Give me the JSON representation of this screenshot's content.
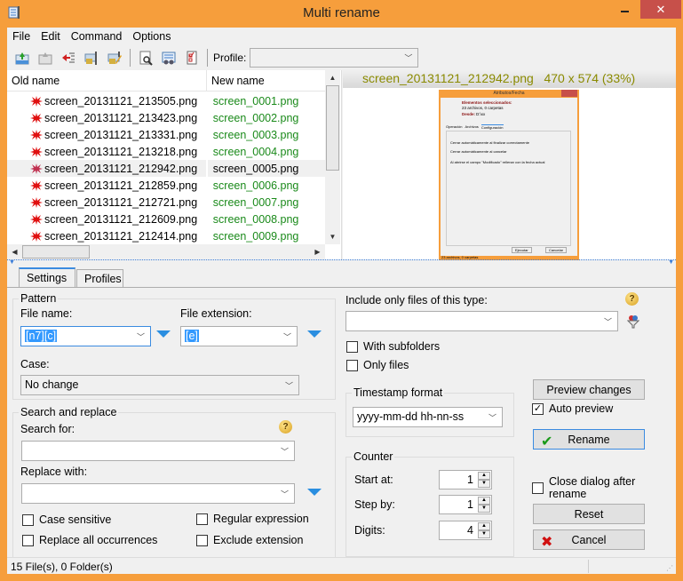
{
  "window": {
    "title": "Multi rename"
  },
  "menu": [
    "File",
    "Edit",
    "Command",
    "Options"
  ],
  "toolbar": {
    "buttons": [
      "load-names-icon",
      "load-names-disabled-icon",
      "undo-icon",
      "lock-rename-icon",
      "edit-rename-icon",
      "preview-icon",
      "compare-icon",
      "checklist-icon"
    ],
    "profile_label": "Profile:",
    "profile_value": ""
  },
  "filelist": {
    "col_old": "Old name",
    "col_new": "New name",
    "rows": [
      {
        "old": "screen_20131121_213505.png",
        "new": "screen_0001.png",
        "selected": false
      },
      {
        "old": "screen_20131121_213423.png",
        "new": "screen_0002.png",
        "selected": false
      },
      {
        "old": "screen_20131121_213331.png",
        "new": "screen_0003.png",
        "selected": false
      },
      {
        "old": "screen_20131121_213218.png",
        "new": "screen_0004.png",
        "selected": false
      },
      {
        "old": "screen_20131121_212942.png",
        "new": "screen_0005.png",
        "selected": true
      },
      {
        "old": "screen_20131121_212859.png",
        "new": "screen_0006.png",
        "selected": false
      },
      {
        "old": "screen_20131121_212721.png",
        "new": "screen_0007.png",
        "selected": false
      },
      {
        "old": "screen_20131121_212609.png",
        "new": "screen_0008.png",
        "selected": false
      },
      {
        "old": "screen_20131121_212414.png",
        "new": "screen_0009.png",
        "selected": false
      }
    ]
  },
  "preview": {
    "filename": "screen_20131121_212942.png",
    "info": "470 x 574 (33%)",
    "thumb": {
      "title": "Atributos/Fecha",
      "selected_label": "Elementos seleccionados:",
      "selected_value": "23 archivos, 0 carpetas",
      "from_label": "Desde:",
      "from_value": "D:\\xx",
      "tabs": [
        "Operación",
        "Archivos",
        "Configuración"
      ],
      "options": [
        {
          "label": "Cerrar automáticamente al finalizar correctamente",
          "checked": true
        },
        {
          "label": "Cerrar automáticamente al cancelar",
          "checked": false
        },
        {
          "label": "Al abrirse el campo \"Modificado\" rellenar con la fecha actual",
          "checked": false
        }
      ],
      "ok": "Ejecutar",
      "cancel": "Cancelar",
      "status": "23 archivos, 0 carpetas"
    }
  },
  "tabs": [
    "Settings",
    "Profiles"
  ],
  "settings": {
    "pattern_title": "Pattern",
    "filename_label": "File name:",
    "filename_value": "[n7][c]",
    "ext_label": "File extension:",
    "ext_value": "[e]",
    "case_label": "Case:",
    "case_value": "No change",
    "sr_title": "Search and replace",
    "search_label": "Search for:",
    "search_value": "",
    "replace_label": "Replace with:",
    "replace_value": "",
    "case_sensitive": "Case sensitive",
    "replace_all": "Replace all occurrences",
    "regex": "Regular expression",
    "exclude_ext": "Exclude extension",
    "include_label": "Include only files of this type:",
    "include_value": "",
    "with_subfolders": "With subfolders",
    "only_files": "Only files",
    "timestamp_title": "Timestamp format",
    "timestamp_value": "yyyy-mm-dd hh-nn-ss",
    "counter_title": "Counter",
    "start_label": "Start at:",
    "start_value": "1",
    "step_label": "Step by:",
    "step_value": "1",
    "digits_label": "Digits:",
    "digits_value": "4",
    "preview_btn": "Preview changes",
    "auto_preview": "Auto preview",
    "auto_preview_checked": true,
    "rename_btn": "Rename",
    "close_after": "Close dialog after rename",
    "reset_btn": "Reset",
    "cancel_btn": "Cancel"
  },
  "status": {
    "text": "15 File(s), 0 Folder(s)"
  },
  "colors": {
    "frame": "#f69e3c",
    "new_name": "#1a8a1a",
    "accent": "#3b8be0",
    "preview_title": "#8a8a00"
  }
}
